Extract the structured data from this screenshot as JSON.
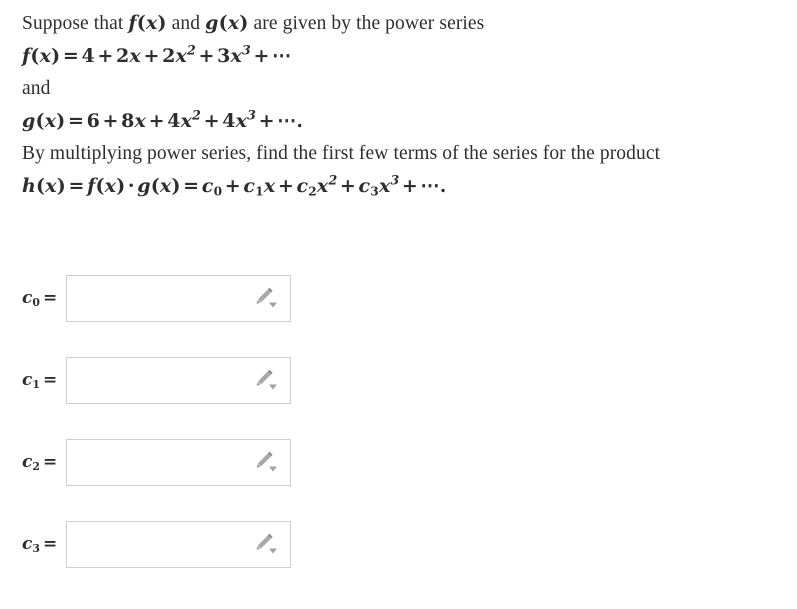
{
  "problem": {
    "line1": {
      "text_a": "Suppose that ",
      "math_f": "f(x)",
      "text_b": " and ",
      "math_g": "g(x)",
      "text_c": " are given by the power series"
    },
    "line2_equation": "f(x) = 4 + 2x + 2x^2 + 3x^3 + ⋯",
    "line3_text": "and",
    "line4_equation": "g(x) = 6 + 8x + 4x^2 + 4x^3 + ⋯.",
    "line5_text": "By multiplying power series, find the first few terms of the series for the product",
    "line6_equation": "h(x) = f(x) · g(x) = c_0 + c_1 x + c_2 x^2 + c_3 x^3 + ⋯."
  },
  "series": {
    "f": {
      "name": "f",
      "coefficients": [
        4,
        2,
        2,
        3
      ],
      "terms": [
        "4",
        "2x",
        "2x²",
        "3x³"
      ],
      "tail": "⋯"
    },
    "g": {
      "name": "g",
      "coefficients": [
        6,
        8,
        4,
        4
      ],
      "terms": [
        "6",
        "8x",
        "4x²",
        "4x³"
      ],
      "tail": "⋯"
    },
    "h": {
      "name": "h",
      "definition": "f(x) · g(x)",
      "coefficient_names": [
        "c₀",
        "c₁",
        "c₂",
        "c₃"
      ],
      "tail": "⋯"
    }
  },
  "answers": [
    {
      "id": "c0",
      "symbol": "c",
      "subscript": "0",
      "equals": "=",
      "value": "",
      "placeholder": "",
      "tool_icon": "pencil-dropdown-icon"
    },
    {
      "id": "c1",
      "symbol": "c",
      "subscript": "1",
      "equals": "=",
      "value": "",
      "placeholder": "",
      "tool_icon": "pencil-dropdown-icon"
    },
    {
      "id": "c2",
      "symbol": "c",
      "subscript": "2",
      "equals": "=",
      "value": "",
      "placeholder": "",
      "tool_icon": "pencil-dropdown-icon"
    },
    {
      "id": "c3",
      "symbol": "c",
      "subscript": "3",
      "equals": "=",
      "value": "",
      "placeholder": "",
      "tool_icon": "pencil-dropdown-icon"
    }
  ],
  "colors": {
    "page_background": "#ffffff",
    "text": "#2e2e2e",
    "input_border": "#cfcfcf",
    "icon_gray": "#9a9a9a"
  }
}
